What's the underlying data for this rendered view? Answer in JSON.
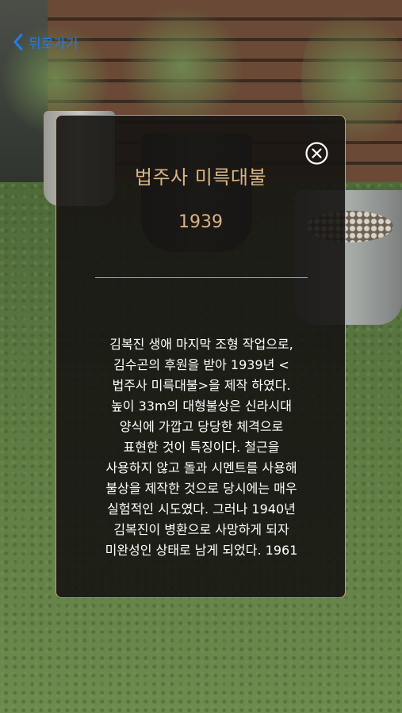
{
  "header": {
    "back_label": "뒤로가기",
    "back_icon": "chevron-left-icon",
    "accent_color": "#1f7cf0"
  },
  "panel": {
    "title": "법주사 미륵대불",
    "year": "1939",
    "close_icon": "close-circle-icon",
    "accent_color": "#c6a06b",
    "body_lines": [
      " 김복진 생애 마지막 조형 작업으로,",
      "김수곤의 후원을 받아 1939년 <",
      "법주사 미륵대불>을 제작 하였다.",
      "높이 33m의 대형불상은 신라시대",
      "양식에 가깝고 당당한 체격으로",
      "표현한 것이 특징이다. 철근을",
      "사용하지 않고 돌과 시멘트를 사용해",
      "불상을 제작한 것으로 당시에는 매우",
      "실험적인 시도였다. 그러나 1940년",
      "김복진이 병환으로 사망하게 되자",
      "미완성인 상태로 남게 되었다. 1961"
    ]
  }
}
